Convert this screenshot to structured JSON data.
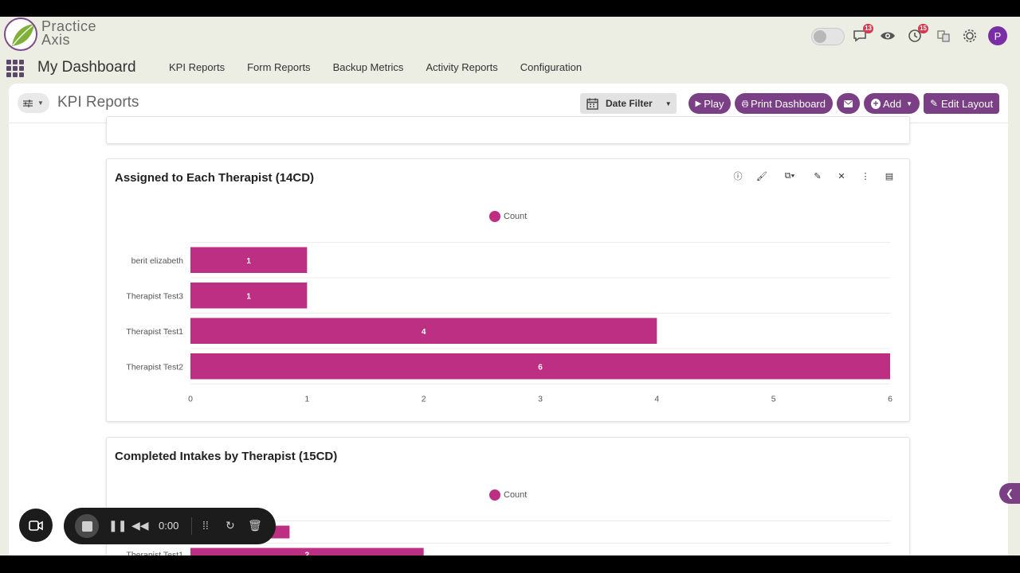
{
  "brand": {
    "line1": "Practice",
    "line2": "Axis",
    "accent": "#7e4b8c"
  },
  "topbar": {
    "chat_badge": "13",
    "clock_badge": "15",
    "avatar_initial": "P"
  },
  "nav": {
    "app_title": "My Dashboard",
    "items": [
      "KPI Reports",
      "Form Reports",
      "Backup Metrics",
      "Activity Reports",
      "Configuration"
    ]
  },
  "subheader": {
    "title": "KPI Reports",
    "date_filter": "Date Filter",
    "play": "Play",
    "print": "Print Dashboard",
    "add": "Add",
    "edit_layout": "Edit Layout"
  },
  "cards": [
    {
      "title": "Assigned to Each Therapist (14CD)",
      "legend": "Count"
    },
    {
      "title": "Completed Intakes by Therapist (15CD)",
      "legend": "Count"
    }
  ],
  "chart_data": [
    {
      "type": "bar",
      "orientation": "horizontal",
      "categories": [
        "berit elizabeth",
        "Therapist Test3",
        "Therapist Test1",
        "Therapist Test2"
      ],
      "series": [
        {
          "name": "Count",
          "values": [
            1,
            1,
            4,
            6
          ]
        }
      ],
      "xlim": [
        0,
        6
      ],
      "xticks": [
        0,
        1,
        2,
        3,
        4,
        5,
        6
      ],
      "color": "#bd2f82"
    },
    {
      "type": "bar",
      "orientation": "horizontal",
      "categories": [
        "",
        "Therapist Test1"
      ],
      "series": [
        {
          "name": "Count",
          "values": [
            0.85,
            2
          ]
        }
      ],
      "xlim": [
        0,
        6
      ],
      "color": "#bd2f82"
    }
  ],
  "recorder": {
    "time": "0:00"
  },
  "colors": {
    "primary": "#7a3f84",
    "bar": "#bd2f82"
  }
}
